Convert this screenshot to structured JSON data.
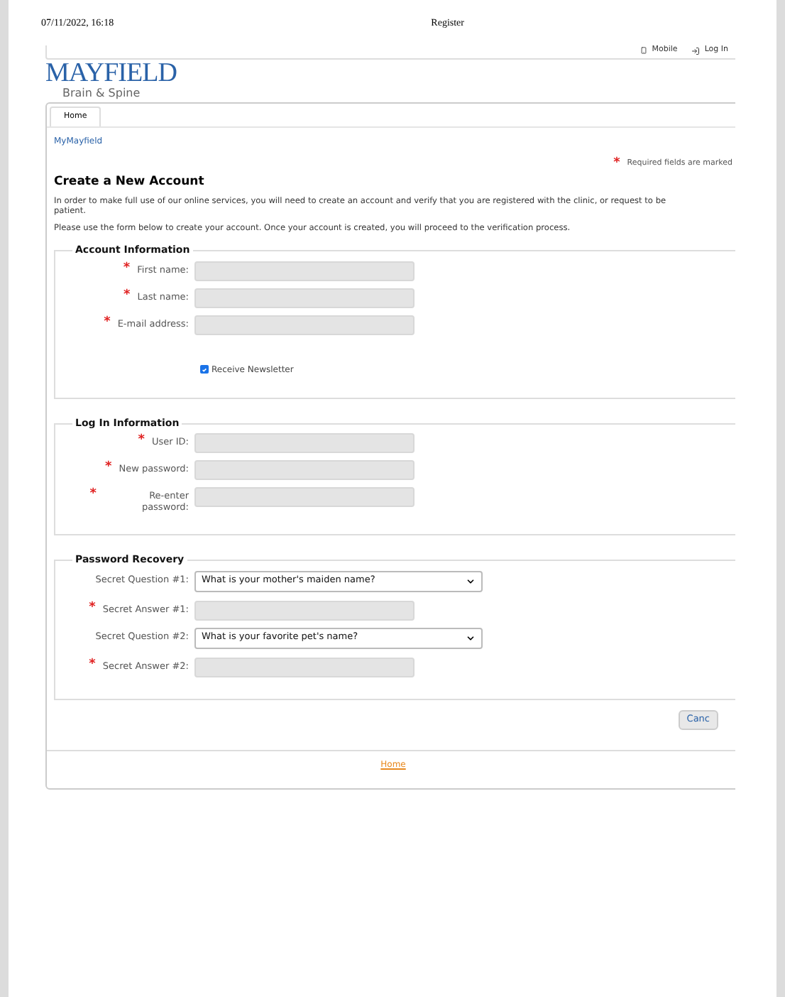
{
  "print_header": {
    "date": "07/11/2022, 16:18",
    "title": "Register"
  },
  "top_links": [
    {
      "kind": "mobile",
      "label": "Mobile"
    },
    {
      "kind": "login",
      "label": "Log In"
    }
  ],
  "logo": {
    "name": "MAYFIELD",
    "tagline": "Brain & Spine"
  },
  "nav_tabs": [
    {
      "label": "Home",
      "selected": true
    }
  ],
  "breadcrumb": "MyMayfield",
  "required_note": {
    "marker": "*",
    "text": "Required fields are marked"
  },
  "heading": "Create a New Account",
  "paragraphs": [
    {
      "lines": [
        "In order to make full use of our online services, you will need to create an account and verify that you are registered with the clinic, or request to be",
        "patient."
      ]
    },
    {
      "lines": [
        "Please use the form below to create your account. Once your account is created, you will proceed to the verification process."
      ]
    }
  ],
  "sections": [
    {
      "title": "Account Information",
      "fields": [
        {
          "kind": "text",
          "label": "First name:",
          "required": true
        },
        {
          "kind": "text",
          "label": "Last name:",
          "required": true
        },
        {
          "kind": "text",
          "label": "E-mail address:",
          "required": true
        },
        {
          "kind": "checkbox",
          "label": "Receive Newsletter",
          "checked": true
        }
      ]
    },
    {
      "title": "Log In Information",
      "fields": [
        {
          "kind": "text",
          "label": "User ID:",
          "required": true
        },
        {
          "kind": "text",
          "label": "New password:",
          "required": true
        },
        {
          "kind": "text",
          "label": "Re-enter password:",
          "required": true
        }
      ]
    },
    {
      "title": "Password Recovery",
      "fields": [
        {
          "kind": "select",
          "label": "Secret Question #1:",
          "required": false,
          "value": "What is your mother's maiden name?"
        },
        {
          "kind": "text",
          "label": "Secret Answer #1:",
          "required": true
        },
        {
          "kind": "select",
          "label": "Secret Question #2:",
          "required": false,
          "value": "What is your favorite pet's name?"
        },
        {
          "kind": "text",
          "label": "Secret Answer #2:",
          "required": true
        }
      ]
    }
  ],
  "buttons": [
    "Canc"
  ],
  "footer_link": "Home"
}
